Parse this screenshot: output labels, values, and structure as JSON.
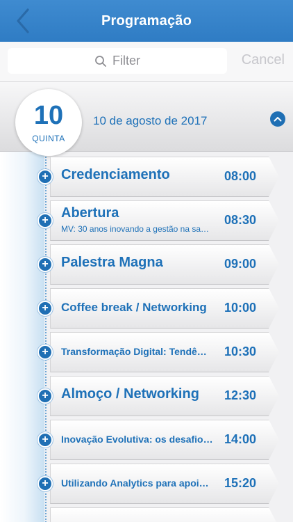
{
  "navbar": {
    "title": "Programação"
  },
  "search": {
    "placeholder": "Filter",
    "cancel_label": "Cancel"
  },
  "day": {
    "number": "10",
    "weekday": "QUINTA",
    "date": "10 de agosto de 2017"
  },
  "events": [
    {
      "title": "Credenciamento",
      "subtitle": "",
      "time": "08:00"
    },
    {
      "title": "Abertura",
      "subtitle": "MV: 30 anos inovando a gestão na sa…",
      "time": "08:30"
    },
    {
      "title": "Palestra Magna",
      "subtitle": "",
      "time": "09:00"
    },
    {
      "title": "Coffee break / Networking",
      "subtitle": "",
      "time": "10:00"
    },
    {
      "title": "Transformação Digital: Tendê…",
      "subtitle": "",
      "time": "10:30"
    },
    {
      "title": "Almoço / Networking",
      "subtitle": "",
      "time": "12:30"
    },
    {
      "title": "Inovação Evolutiva: os desafio…",
      "subtitle": "",
      "time": "14:00"
    },
    {
      "title": "Utilizando Analytics para apoi…",
      "subtitle": "",
      "time": "15:20"
    }
  ],
  "colors": {
    "primary": "#1e71b8",
    "navbar": "#3f8bd0"
  }
}
